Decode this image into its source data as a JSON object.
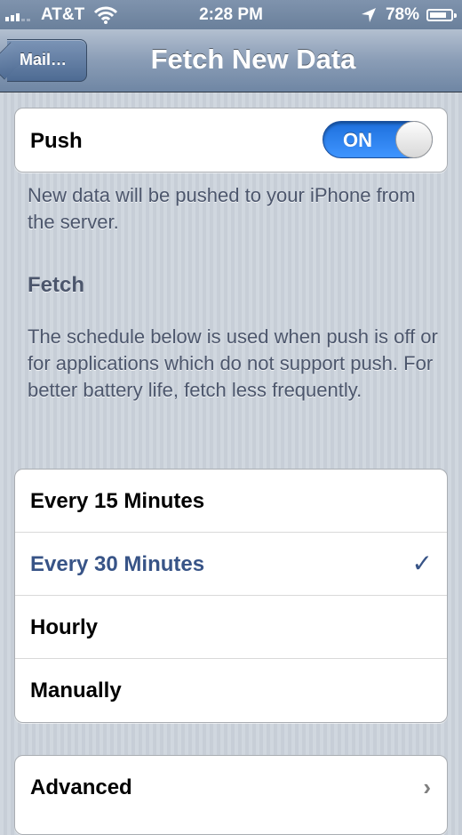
{
  "status_bar": {
    "carrier": "AT&T",
    "time": "2:28 PM",
    "battery": "78%"
  },
  "nav": {
    "back_label": "Mail…",
    "title": "Fetch New Data"
  },
  "push": {
    "label": "Push",
    "toggle_label": "ON",
    "enabled": true
  },
  "push_note": "New data will be pushed to your iPhone from the server.",
  "fetch": {
    "header": "Fetch",
    "note": "The schedule below is used when push is off or for applications which do not support push. For better battery life, fetch less frequently.",
    "options": [
      {
        "label": "Every 15 Minutes",
        "selected": false
      },
      {
        "label": "Every 30 Minutes",
        "selected": true
      },
      {
        "label": "Hourly",
        "selected": false
      },
      {
        "label": "Manually",
        "selected": false
      }
    ],
    "check_glyph": "✓"
  },
  "advanced": {
    "label": "Advanced",
    "chevron": "›"
  },
  "colors": {
    "selected_text": "#385487",
    "toggle_on": "#2f86f2",
    "nav_bar": "#8a9db6"
  }
}
